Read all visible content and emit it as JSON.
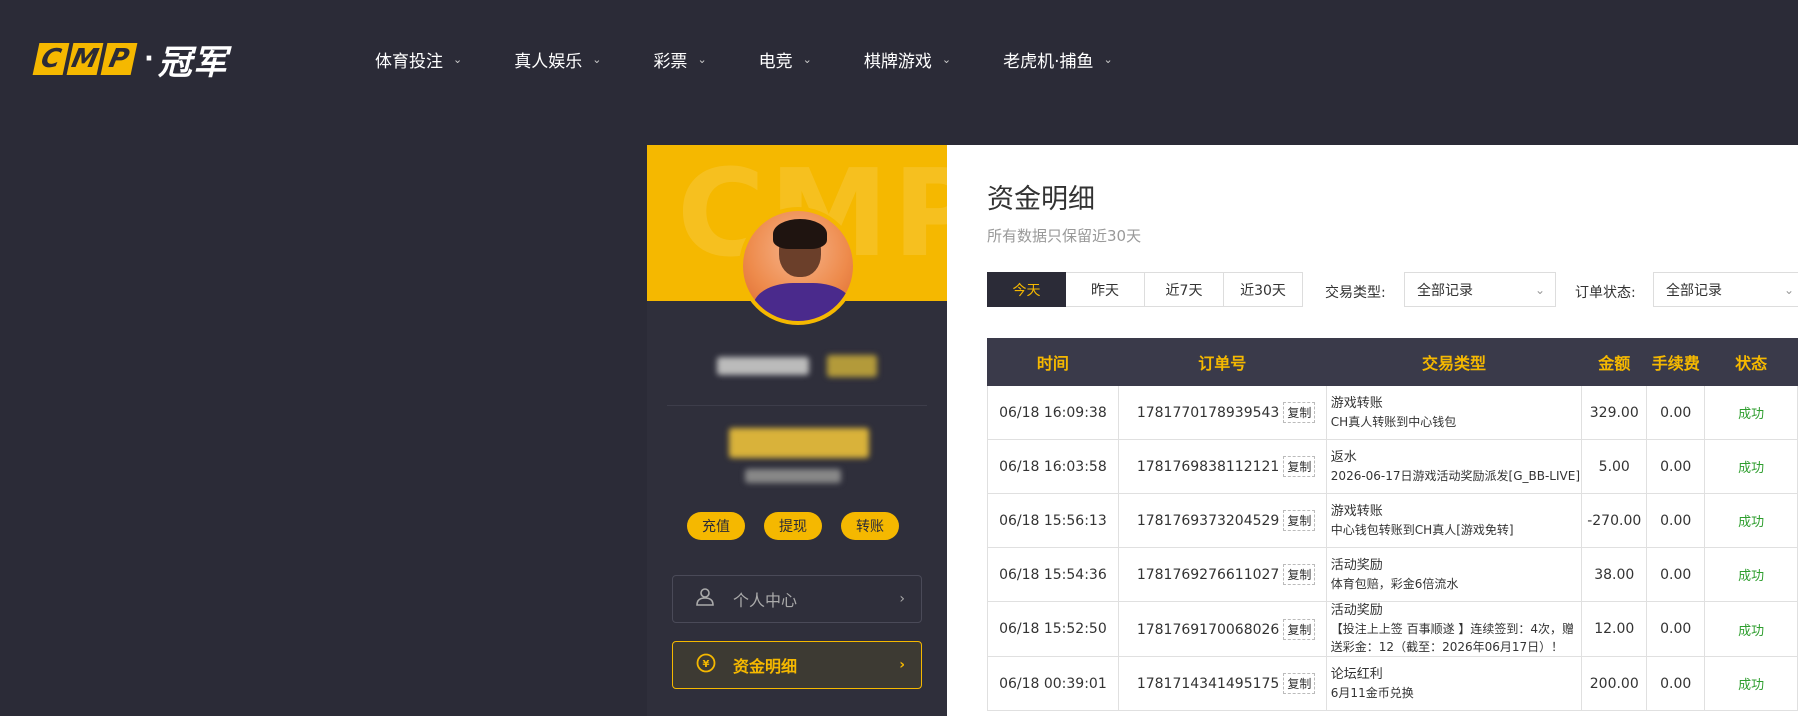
{
  "brand": {
    "logo_letters": [
      "C",
      "M",
      "P"
    ],
    "logo_dot": "·",
    "logo_text": "冠军"
  },
  "nav": [
    {
      "label": "体育投注"
    },
    {
      "label": "真人娱乐"
    },
    {
      "label": "彩票"
    },
    {
      "label": "电竞"
    },
    {
      "label": "棋牌游戏"
    },
    {
      "label": "老虎机·捕鱼"
    }
  ],
  "sidebar": {
    "banner_watermark": "CMP",
    "actions": {
      "deposit": "充值",
      "withdraw": "提现",
      "transfer": "转账"
    },
    "menu": [
      {
        "label": "个人中心",
        "icon": "user-icon"
      },
      {
        "label": "资金明细",
        "icon": "funds-icon"
      }
    ]
  },
  "main": {
    "title": "资金明细",
    "subtitle": "所有数据只保留近30天",
    "tabs": [
      "今天",
      "昨天",
      "近7天",
      "近30天"
    ],
    "active_tab": "今天",
    "filters": {
      "type_label": "交易类型:",
      "type_value": "全部记录",
      "status_label": "订单状态:",
      "status_value": "全部记录"
    },
    "table": {
      "headers": [
        "时间",
        "订单号",
        "交易类型",
        "金额",
        "手续费",
        "状态"
      ],
      "copy_label": "复制",
      "rows": [
        {
          "time": "06/18 16:09:38",
          "order": "1781770178939543",
          "type": "游戏转账",
          "type_detail": "CH真人转账到中心钱包",
          "amount": "329.00",
          "fee": "0.00",
          "status": "成功"
        },
        {
          "time": "06/18 16:03:58",
          "order": "1781769838112121",
          "type": "返水",
          "type_detail": "2026-06-17日游戏活动奖励派发[G_BB-LIVE]",
          "amount": "5.00",
          "fee": "0.00",
          "status": "成功"
        },
        {
          "time": "06/18 15:56:13",
          "order": "1781769373204529",
          "type": "游戏转账",
          "type_detail": "中心钱包转账到CH真人[游戏免转]",
          "amount": "-270.00",
          "fee": "0.00",
          "status": "成功"
        },
        {
          "time": "06/18 15:54:36",
          "order": "1781769276611027",
          "type": "活动奖励",
          "type_detail": "体育包赔，彩金6倍流水",
          "amount": "38.00",
          "fee": "0.00",
          "status": "成功"
        },
        {
          "time": "06/18 15:52:50",
          "order": "1781769170068026",
          "type": "活动奖励",
          "type_detail": "【投注上上签 百事顺遂 】连续签到：4次，赠送彩金：12（截至：2026年06月17日）！",
          "amount": "12.00",
          "fee": "0.00",
          "status": "成功"
        },
        {
          "time": "06/18 00:39:01",
          "order": "1781714341495175",
          "type": "论坛红利",
          "type_detail": "6月11金币兑换",
          "amount": "200.00",
          "fee": "0.00",
          "status": "成功"
        }
      ]
    }
  }
}
